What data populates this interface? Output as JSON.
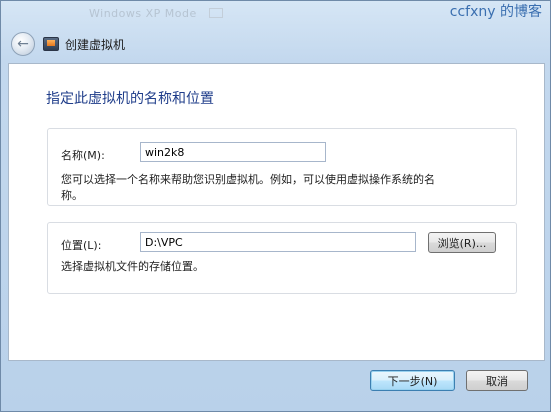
{
  "background_window": {
    "title": "Windows XP Mode"
  },
  "watermark": "ccfxny 的博客",
  "header": {
    "title": "创建虚拟机"
  },
  "page": {
    "heading": "指定此虚拟机的名称和位置"
  },
  "name_group": {
    "label": "名称(M):",
    "value": "win2k8",
    "help_line1": "您可以选择一个名称来帮助您识别虚拟机。例如，可以使用虚拟操作系统的名",
    "help_line2": "称。"
  },
  "location_group": {
    "label": "位置(L):",
    "value": "D:\\VPC",
    "browse_label": "浏览(R)...",
    "help": "选择虚拟机文件的存储位置。"
  },
  "footer": {
    "next_label": "下一步(N)",
    "cancel_label": "取消"
  }
}
